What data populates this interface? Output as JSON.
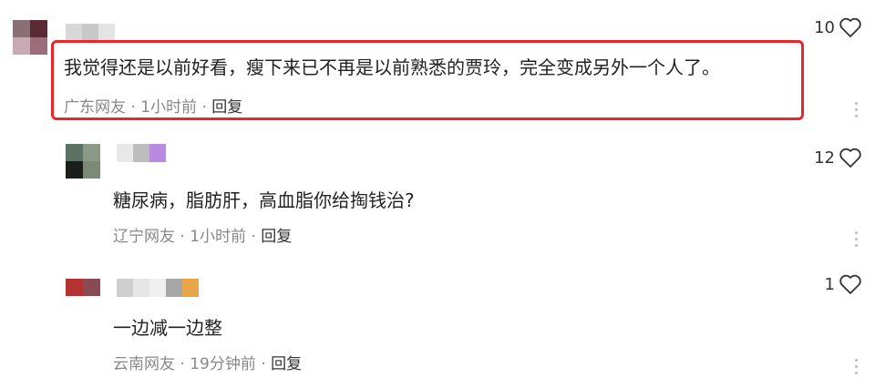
{
  "comments": [
    {
      "text": "我觉得还是以前好看，瘦下来已不再是以前熟悉的贾玲，完全变成另外一个人了。",
      "location": "广东网友",
      "time": "1小时前",
      "sep": "·",
      "reply_label": "回复",
      "likes": "10",
      "highlighted": true,
      "avatar_colors": [
        "#8a6f77",
        "#5a2a35",
        "#c9aab4",
        "#9b6d79"
      ],
      "name_colors": [
        "#d8d8d8",
        "#c8c8c8",
        "#e4e4e4"
      ]
    },
    {
      "text": "糖尿病，脂肪肝，高血脂你给掏钱治?",
      "location": "辽宁网友",
      "time": "1小时前",
      "sep": "·",
      "reply_label": "回复",
      "likes": "12",
      "avatar_colors": [
        "#5c7262",
        "#8a9a87",
        "#1a1f1b",
        "#7a8a74"
      ],
      "name_colors": [
        "#e8e8e8",
        "#bdbdbd",
        "#b98be0"
      ]
    },
    {
      "text": "一边减一边整",
      "location": "云南网友",
      "time": "19分钟前",
      "sep": "·",
      "reply_label": "回复",
      "likes": "1",
      "avatar_colors": [
        "#b43232",
        "#8a4a52",
        "#ffffff",
        "#ffffff"
      ],
      "name_colors": [
        "#cfcfcf",
        "#e6e6e6",
        "#f0f0f0",
        "#a7a7a7",
        "#e9a54a"
      ]
    }
  ],
  "icons": {
    "like": "heart-outline-icon",
    "more": "vertical-dots-icon"
  }
}
